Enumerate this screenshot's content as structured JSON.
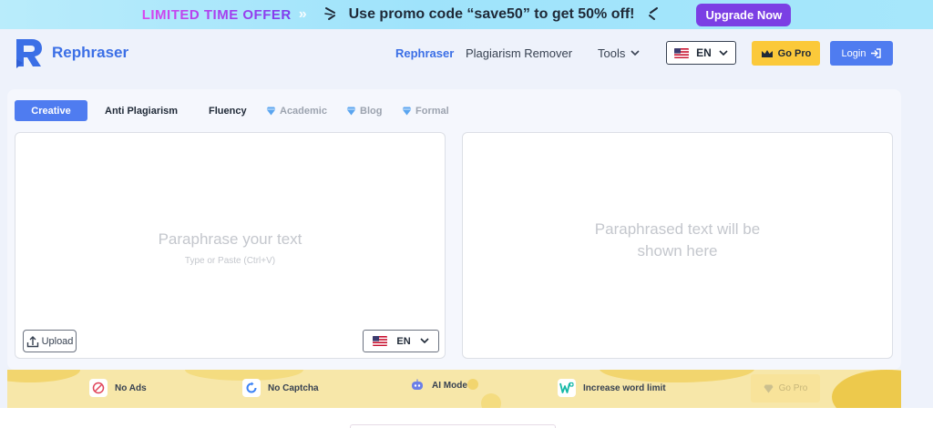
{
  "promo": {
    "offer_label": "LIMITED TIME OFFER",
    "message": "Use promo code “save50” to get 50% off!",
    "upgrade_label": "Upgrade Now"
  },
  "header": {
    "brand": "Rephraser",
    "nav": {
      "rephraser": "Rephraser",
      "plagiarism_remover": "Plagiarism Remover",
      "tools": "Tools"
    },
    "language": "EN",
    "gopro_label": "Go Pro",
    "login_label": "Login"
  },
  "modes": {
    "creative": "Creative",
    "anti_plagiarism": "Anti Plagiarism",
    "fluency": "Fluency",
    "academic": "Academic",
    "blog": "Blog",
    "formal": "Formal"
  },
  "input": {
    "placeholder": "Paraphrase your text",
    "hint": "Type or Paste (Ctrl+V)",
    "upload_label": "Upload",
    "language": "EN"
  },
  "output": {
    "placeholder_line1": "Paraphrased text will be",
    "placeholder_line2": "shown here"
  },
  "features": {
    "no_ads": "No Ads",
    "no_captcha": "No Captcha",
    "ai_mode": "AI Mode",
    "word_limit": "Increase word limit",
    "gopro_label": "Go Pro"
  },
  "colors": {
    "accent": "#4f7cf0",
    "brand": "#3b6fe6",
    "gold": "#fbc93a",
    "promo_purple": "#7b3fe4"
  }
}
